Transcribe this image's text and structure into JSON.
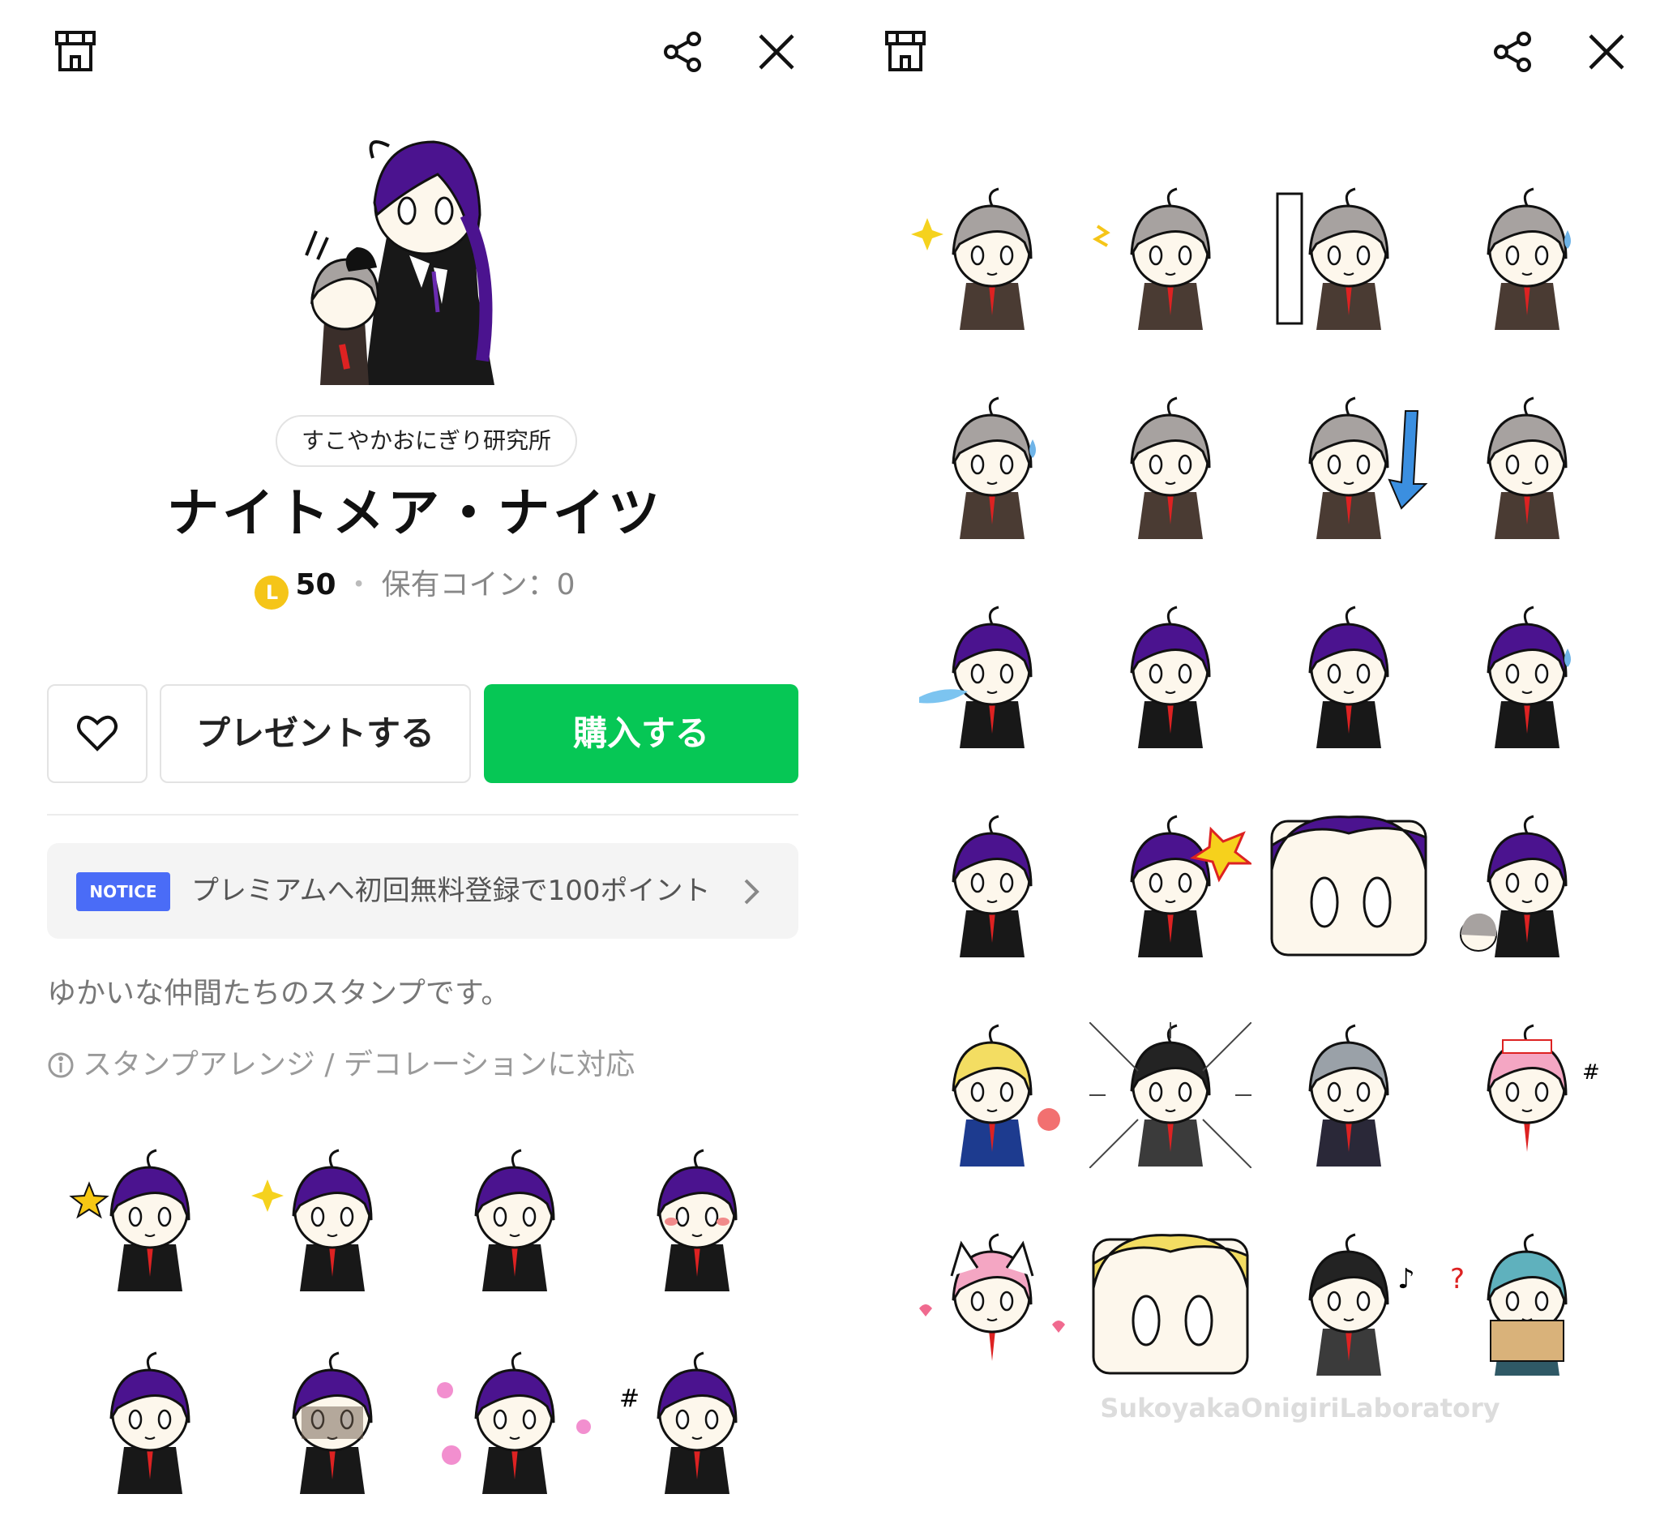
{
  "colors": {
    "buy_green": "#06c755",
    "notice_blue": "#4a6cf7",
    "coin_yellow": "#f5c518",
    "hair_purple": "#4b138f",
    "hair_gray": "#a7a2a0"
  },
  "left": {
    "toolbar": {
      "shop_icon": "shop-icon",
      "share_icon": "share-icon",
      "close_icon": "close-icon"
    },
    "author": "すこやかおにぎり研究所",
    "title": "ナイトメア・ナイツ",
    "price": {
      "coin_glyph": "L",
      "amount": "50",
      "separator": "・",
      "owned": "保有コイン：0"
    },
    "buttons": {
      "like_icon": "heart-icon",
      "gift": "プレゼントする",
      "buy": "購入する"
    },
    "notice": {
      "badge": "NOTICE",
      "text": "プレミアムへ初回無料登録で100ポイント…"
    },
    "description": "ゆかいな仲間たちのスタンプです。",
    "feature": "スタンプアレンジ / デコレーションに対応"
  },
  "right": {
    "toolbar": {
      "shop_icon": "shop-icon",
      "share_icon": "share-icon",
      "close_icon": "close-icon"
    },
    "watermark": "SukoyakaOnigiriLaboratory"
  },
  "stickers": {
    "left_grid": [
      {
        "hair": "purple",
        "extra": "star"
      },
      {
        "hair": "purple",
        "extra": "sparkle"
      },
      {
        "hair": "purple",
        "extra": "none"
      },
      {
        "hair": "purple",
        "extra": "blush"
      },
      {
        "hair": "purple",
        "extra": "none"
      },
      {
        "hair": "purple",
        "extra": "shade"
      },
      {
        "hair": "purple",
        "extra": "flowers"
      },
      {
        "hair": "purple",
        "extra": "angry"
      }
    ],
    "right_grid": [
      {
        "hair": "gray",
        "extra": "sparkle"
      },
      {
        "hair": "gray",
        "extra": "shock"
      },
      {
        "hair": "gray",
        "extra": "wall"
      },
      {
        "hair": "gray",
        "extra": "sweat"
      },
      {
        "hair": "gray",
        "extra": "sweat"
      },
      {
        "hair": "gray",
        "extra": "none"
      },
      {
        "hair": "gray",
        "extra": "arrow"
      },
      {
        "hair": "gray",
        "extra": "none"
      },
      {
        "hair": "purple",
        "extra": "breath"
      },
      {
        "hair": "purple",
        "extra": "none"
      },
      {
        "hair": "purple",
        "extra": "none"
      },
      {
        "hair": "purple",
        "extra": "sweat"
      },
      {
        "hair": "purple",
        "extra": "none"
      },
      {
        "hair": "purple",
        "extra": "burst"
      },
      {
        "hair": "purple",
        "extra": "closeup"
      },
      {
        "hair": "purple",
        "extra": "duo"
      },
      {
        "hair": "blonde",
        "extra": "flower"
      },
      {
        "hair": "black",
        "extra": "lines"
      },
      {
        "hair": "silver",
        "extra": "none"
      },
      {
        "hair": "pink",
        "extra": "nurse"
      },
      {
        "hair": "pink",
        "extra": "catcap"
      },
      {
        "hair": "blonde",
        "extra": "closeup"
      },
      {
        "hair": "black",
        "extra": "note"
      },
      {
        "hair": "teal",
        "extra": "map"
      }
    ]
  }
}
